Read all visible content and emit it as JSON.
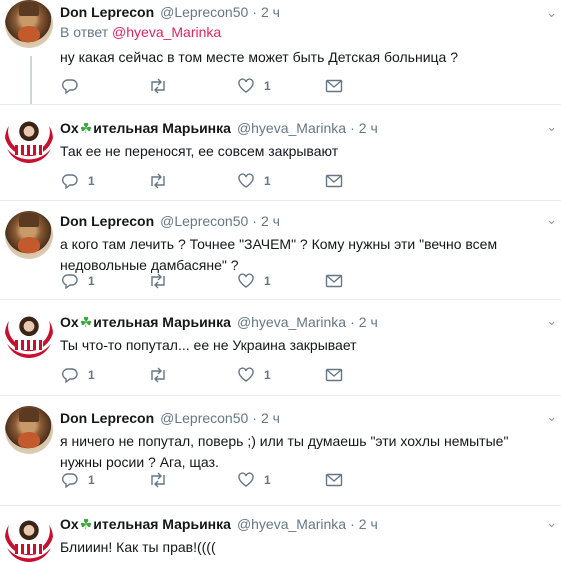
{
  "tweets": [
    {
      "name": "Don Leprecon",
      "name_suffix": "",
      "handle": "@Leprecon50",
      "time": "2 ч",
      "reply_label": "В ответ",
      "reply_mention": "@hyeva_Marinka",
      "text": "ну какая сейчас в том месте может быть Детская больница ?",
      "reply_count": "",
      "retweet_count": "",
      "like_count": "1"
    },
    {
      "name": "Ох",
      "name_suffix": "ительная Марьинка",
      "handle": "@hyeva_Marinka",
      "time": "2 ч",
      "text": "Так ее не переносят, ее совсем закрывают",
      "reply_count": "1",
      "retweet_count": "",
      "like_count": "1"
    },
    {
      "name": "Don Leprecon",
      "name_suffix": "",
      "handle": "@Leprecon50",
      "time": "2 ч",
      "text": "а кого там лечить ? Точнее \"ЗАЧЕМ\" ? Кому нужны эти \"вечно всем недовольные дамбасяне\" ?",
      "reply_count": "1",
      "retweet_count": "",
      "like_count": "1"
    },
    {
      "name": "Ох",
      "name_suffix": "ительная Марьинка",
      "handle": "@hyeva_Marinka",
      "time": "2 ч",
      "text": "Ты что-то попутал... ее не Украина закрывает",
      "reply_count": "1",
      "retweet_count": "",
      "like_count": "1"
    },
    {
      "name": "Don Leprecon",
      "name_suffix": "",
      "handle": "@Leprecon50",
      "time": "2 ч",
      "text": "я ничего не попутал, поверь ;) или ты думаешь \"эти хохлы немытые\" нужны росии ? Ага, щаз.",
      "reply_count": "1",
      "retweet_count": "",
      "like_count": "1"
    },
    {
      "name": "Ох",
      "name_suffix": "ительная Марьинка",
      "handle": "@hyeva_Marinka",
      "time": "2 ч",
      "text": "Блииин! Как ты прав!((((",
      "reply_count": "",
      "retweet_count": "",
      "like_count": ""
    }
  ],
  "icons": {
    "clover": "☘",
    "more": "chevron-down-icon",
    "reply": "reply-icon",
    "retweet": "retweet-icon",
    "like": "heart-icon",
    "dm": "envelope-icon"
  },
  "colors": {
    "name": "#14171a",
    "meta": "#657786",
    "mention": "#e0245e",
    "clover": "#3aa53a",
    "thread_line": "#ccd6dd",
    "separator": "#e6ecf0"
  }
}
